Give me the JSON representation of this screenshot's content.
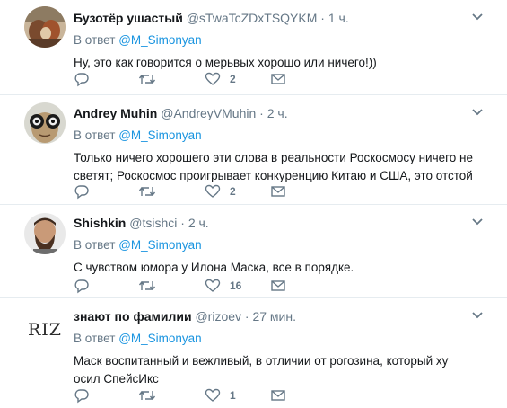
{
  "tweets": [
    {
      "name": "Бузотёр ушастый",
      "handle": "@sTwaTcZDxTSQYKM",
      "dot": "·",
      "time": "1 ч.",
      "reply_prefix": "В ответ",
      "reply_to": "@M_Simonyan",
      "text": "Ну, это как говорится о мерьвых хорошо или ничего!))",
      "likes": "2"
    },
    {
      "name": "Andrey Muhin",
      "handle": "@AndreyVMuhin",
      "dot": "·",
      "time": "2 ч.",
      "reply_prefix": "В ответ",
      "reply_to": "@M_Simonyan",
      "text": "Только ничего хорошего эти слова в реальности Роскосмосу ничего не светят; Роскосмос проигрывает конкуренцию Китаю и США, это отстой",
      "likes": "2"
    },
    {
      "name": "Shishkin",
      "handle": "@tsishci",
      "dot": "·",
      "time": "2 ч.",
      "reply_prefix": "В ответ",
      "reply_to": "@M_Simonyan",
      "text": "С чувством юмора у Илона Маска, все в порядке.",
      "likes": "16"
    },
    {
      "name": "знают по фамилии",
      "handle": "@rizoev",
      "dot": "·",
      "time": "27 мин.",
      "reply_prefix": "В ответ",
      "reply_to": "@M_Simonyan",
      "text": "Маск воспитанный и вежливый, в отличии от рогозина, который ху     осил СпейсИкс",
      "likes": "1",
      "avatar_text": "RIZ"
    }
  ],
  "colors": {
    "link": "#1b95e0",
    "muted": "#657786",
    "text": "#14171a",
    "divider": "#e6ecf0"
  },
  "icons": [
    "reply-icon",
    "retweet-icon",
    "like-icon",
    "message-icon",
    "chevron-down-icon"
  ]
}
